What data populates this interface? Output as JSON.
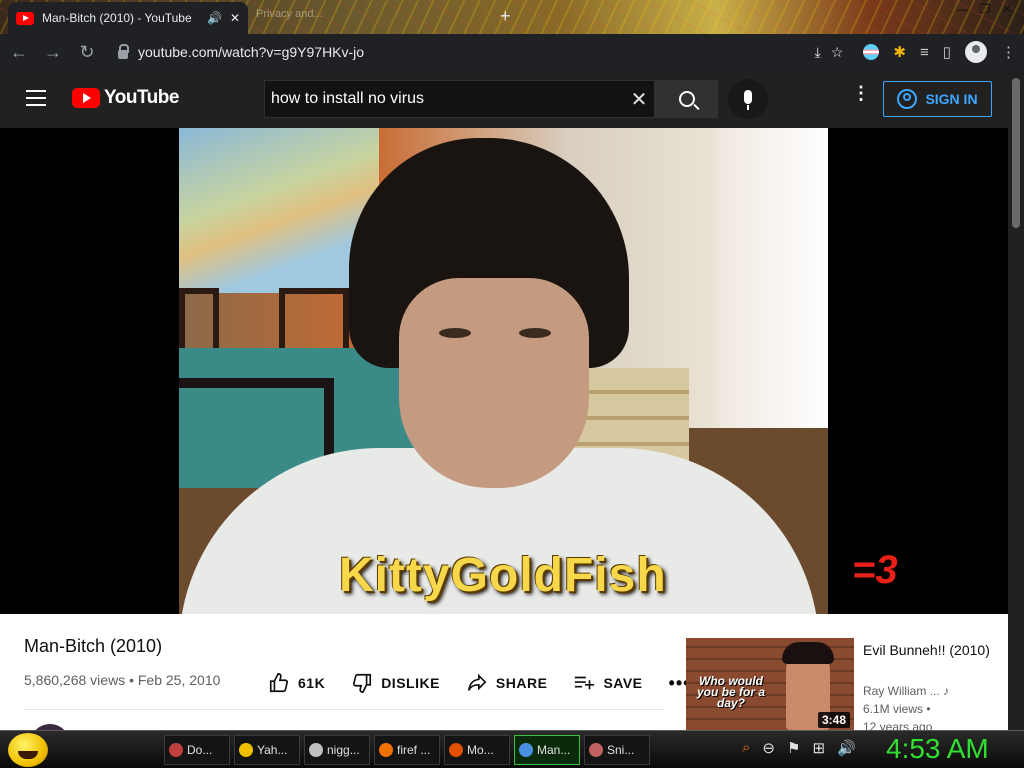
{
  "browser": {
    "tab_title": "Man-Bitch (2010) - YouTube",
    "tab_audio_icon": "🔊",
    "tab_close": "✕",
    "second_tab": "Privacy and...",
    "new_tab": "+",
    "win_min": "—",
    "win_max": "❐",
    "win_close": "✕",
    "url": "youtube.com/watch?v=g9Y97HKv-jo",
    "back": "←",
    "forward": "→",
    "reload": "↻",
    "ext_install": "⤓",
    "ext_star": "☆",
    "ext_puzzle": "✱",
    "ext_playlist": "≡",
    "ext_sidebar": "▯",
    "ext_menu": "⋮"
  },
  "youtube": {
    "logo_text": "YouTube",
    "search_query": "how to install no virus",
    "clear": "✕",
    "kebab": "⋮",
    "sign_in": "SIGN IN"
  },
  "video": {
    "caption": "KittyGoldFish",
    "watermark": "=3",
    "title": "Man-Bitch (2010)",
    "views": "5,860,268 views",
    "dot": "•",
    "date": "Feb 25, 2010",
    "likes": "61K",
    "dislike": "DISLIKE",
    "share": "SHARE",
    "save": "SAVE",
    "more": "•••"
  },
  "recommendation": {
    "thumb_text": "Who would you be for a day?",
    "duration": "3:48",
    "title": "Evil Bunneh!! (2010)",
    "channel": "Ray William ...",
    "music_icon": "♪",
    "views": "6.1M views •",
    "ago": "12 years ago"
  },
  "taskbar": {
    "tasks": [
      {
        "label": "Do...",
        "color": "#c04040"
      },
      {
        "label": "Yah...",
        "color": "#f0c000"
      },
      {
        "label": "nigg...",
        "color": "#c0c0c0"
      },
      {
        "label": "firef ...",
        "color": "#f07000"
      },
      {
        "label": "Mo...",
        "color": "#e05000"
      },
      {
        "label": "Man...",
        "color": "#4a90e2"
      },
      {
        "label": "Sni...",
        "color": "#c06060"
      }
    ],
    "tray_search": "⌕",
    "tray_minus": "⊖",
    "tray_flag": "⚑",
    "tray_net": "⊞",
    "tray_volume": "🔊",
    "clock": "4:53 AM"
  }
}
